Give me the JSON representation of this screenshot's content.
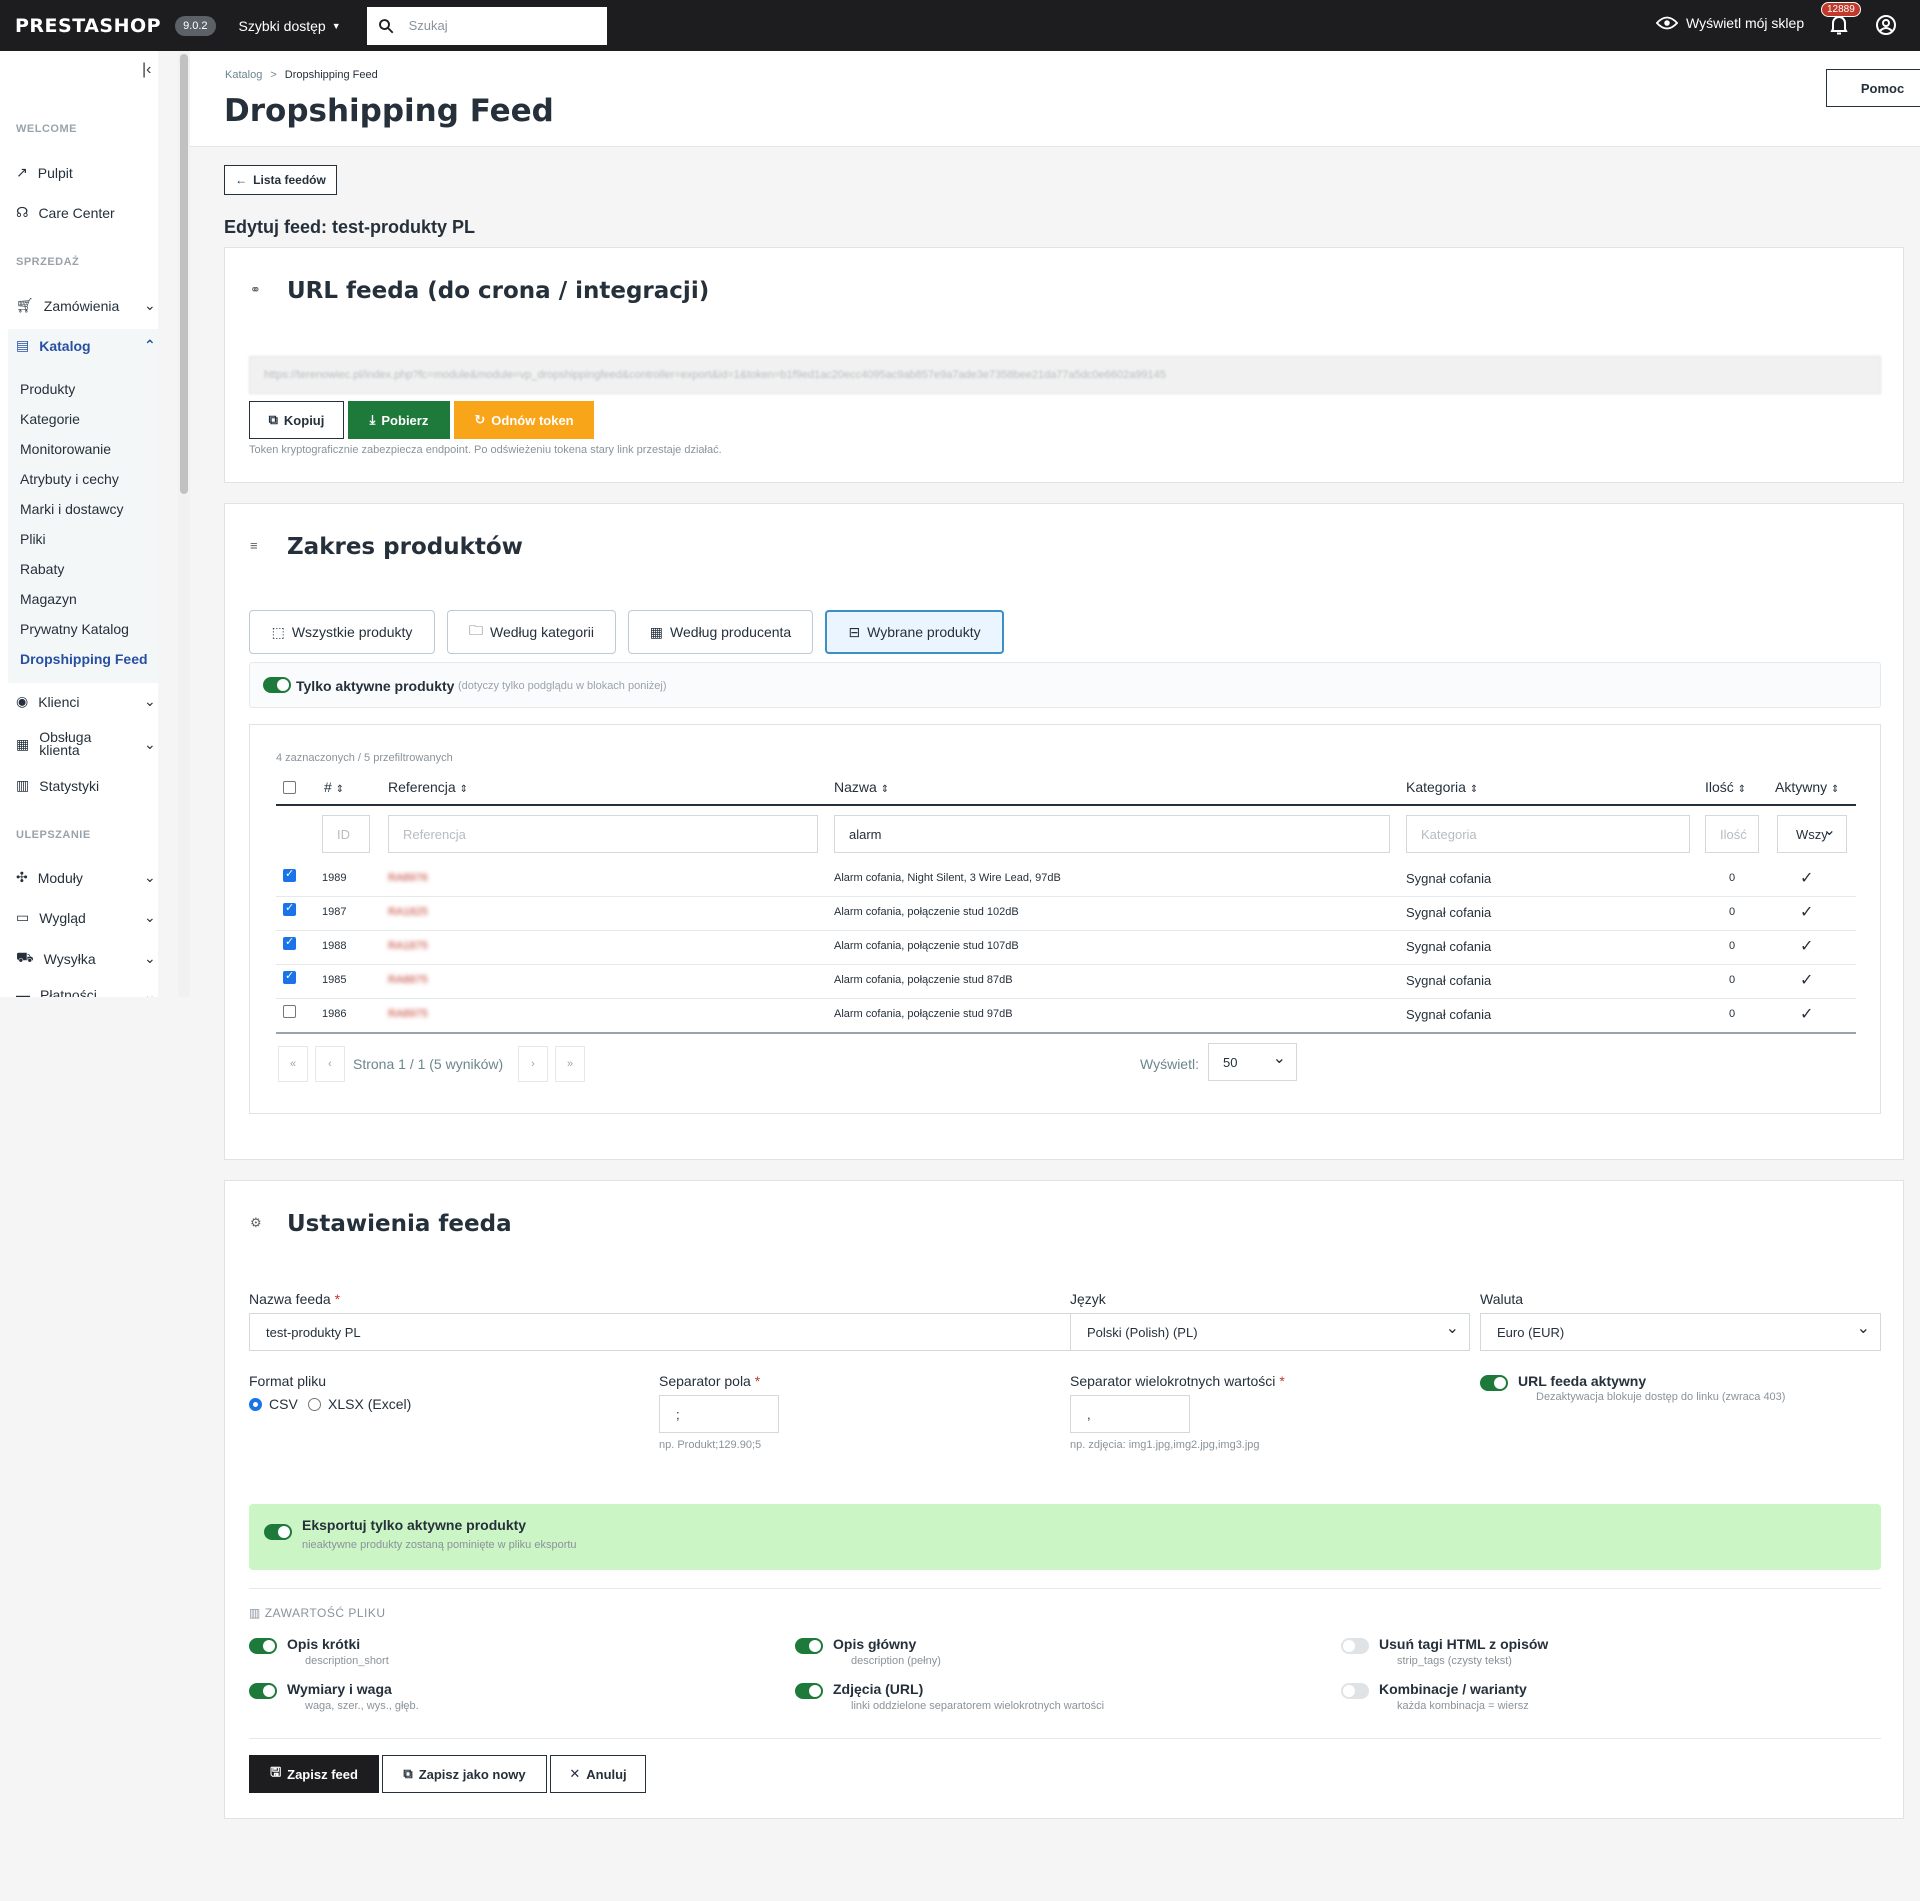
{
  "topbar": {
    "logo": "PRESTASHOP",
    "version": "9.0.2",
    "quick_access": "Szybki dostęp",
    "search_placeholder": "Szukaj",
    "view_shop": "Wyświetl mój sklep",
    "notif_count": "12889"
  },
  "sidebar": {
    "sections": [
      "WELCOME",
      "SPRZEDAŻ",
      "ULEPSZANIE"
    ],
    "items": [
      "Pulpit",
      "Care Center",
      "Zamówienia",
      "Katalog",
      "Klienci",
      "Obsługa klienta",
      "Statystyki",
      "Moduły",
      "Wygląd",
      "Wysyłka",
      "Płatności"
    ],
    "catalog_sub": [
      "Produkty",
      "Kategorie",
      "Monitorowanie",
      "Atrybuty i cechy",
      "Marki i dostawcy",
      "Pliki",
      "Rabaty",
      "Magazyn",
      "Prywatny Katalog",
      "Dropshipping Feed"
    ]
  },
  "header": {
    "breadcrumb": [
      "Katalog",
      ">",
      "Dropshipping Feed"
    ],
    "title": "Dropshipping Feed",
    "help": "Pomoc"
  },
  "back_button": "Lista feedów",
  "edit_title": "Edytuj feed: test-produkty PL",
  "url_card": {
    "title": "URL feeda (do crona / integracji)",
    "url": "https://terenowiec.pl/index.php?fc=module&module=vp_dropshippingfeed&controller=export&id=1&token=b1f9ed1ac20ecc4095ac9ab857e9a7ade3e7358bee21da77a5dc0e6602a99145",
    "copy": "Kopiuj",
    "download": "Pobierz",
    "renew": "Odnów token",
    "hint": "Token kryptograficznie zabezpiecza endpoint. Po odświeżeniu tokena stary link przestaje działać."
  },
  "scope_card": {
    "title": "Zakres produktów",
    "tabs": [
      "Wszystkie produkty",
      "Według kategorii",
      "Według producenta",
      "Wybrane produkty"
    ],
    "only_active": "Tylko aktywne produkty",
    "only_active_note": "(dotyczy tylko podglądu w blokach poniżej)",
    "summary": "4 zaznaczonych / 5 przefiltrowanych",
    "columns": [
      "#",
      "Referencja",
      "Nazwa",
      "Kategoria",
      "Ilość",
      "Aktywny"
    ],
    "filters": {
      "id": "ID",
      "ref": "Referencja",
      "name": "alarm",
      "cat": "Kategoria",
      "qty": "Ilość",
      "active": "Wszy"
    },
    "rows": [
      {
        "checked": true,
        "id": "1989",
        "ref": "RA8976",
        "name": "Alarm cofania, Night Silent, 3 Wire Lead, 97dB",
        "cat": "Sygnał cofania",
        "qty": "0",
        "active": "✓"
      },
      {
        "checked": true,
        "id": "1987",
        "ref": "RA1825",
        "name": "Alarm cofania, połączenie stud 102dB",
        "cat": "Sygnał cofania",
        "qty": "0",
        "active": "✓"
      },
      {
        "checked": true,
        "id": "1988",
        "ref": "RA1875",
        "name": "Alarm cofania, połączenie stud 107dB",
        "cat": "Sygnał cofania",
        "qty": "0",
        "active": "✓"
      },
      {
        "checked": true,
        "id": "1985",
        "ref": "RA8875",
        "name": "Alarm cofania, połączenie stud 87dB",
        "cat": "Sygnał cofania",
        "qty": "0",
        "active": "✓"
      },
      {
        "checked": false,
        "id": "1986",
        "ref": "RA8975",
        "name": "Alarm cofania, połączenie stud 97dB",
        "cat": "Sygnał cofania",
        "qty": "0",
        "active": "✓"
      }
    ],
    "pagination": {
      "first": "«",
      "prev": "‹",
      "text": "Strona 1 / 1  (5 wyników)",
      "next": "›",
      "last": "»",
      "show_label": "Wyświetl:",
      "per_page": "50"
    }
  },
  "settings_card": {
    "title": "Ustawienia feeda",
    "name_label": "Nazwa feeda",
    "name_value": "test-produkty PL",
    "lang_label": "Język",
    "lang_value": "Polski (Polish) (PL)",
    "currency_label": "Waluta",
    "currency_value": "Euro (EUR)",
    "format_label": "Format pliku",
    "format_csv": "CSV",
    "format_xlsx": "XLSX (Excel)",
    "sep_label": "Separator pola",
    "sep_value": ";",
    "sep_hint": "np. Produkt;129.90;5",
    "multi_label": "Separator wielokrotnych wartości",
    "multi_value": ",",
    "multi_hint": "np. zdjęcia: img1.jpg,img2.jpg,img3.jpg",
    "url_active": "URL feeda aktywny",
    "url_active_sub": "Dezaktywacja blokuje dostęp do linku (zwraca 403)",
    "export_active": "Eksportuj tylko aktywne produkty",
    "export_active_sub": "nieaktywne produkty zostaną pominięte w pliku eksportu",
    "content_label": "ZAWARTOŚĆ PLIKU",
    "toggles": [
      {
        "title": "Opis krótki",
        "sub": "description_short",
        "on": true
      },
      {
        "title": "Opis główny",
        "sub": "description (pełny)",
        "on": true
      },
      {
        "title": "Usuń tagi HTML z opisów",
        "sub": "strip_tags (czysty tekst)",
        "on": false
      },
      {
        "title": "Wymiary i waga",
        "sub": "waga, szer., wys., głęb.",
        "on": true
      },
      {
        "title": "Zdjęcia (URL)",
        "sub": "linki oddzielone separatorem wielokrotnych wartości",
        "on": true
      },
      {
        "title": "Kombinacje / warianty",
        "sub": "każda kombinacja = wiersz",
        "on": false
      }
    ],
    "save": "Zapisz feed",
    "save_new": "Zapisz jako nowy",
    "cancel": "Anuluj"
  }
}
